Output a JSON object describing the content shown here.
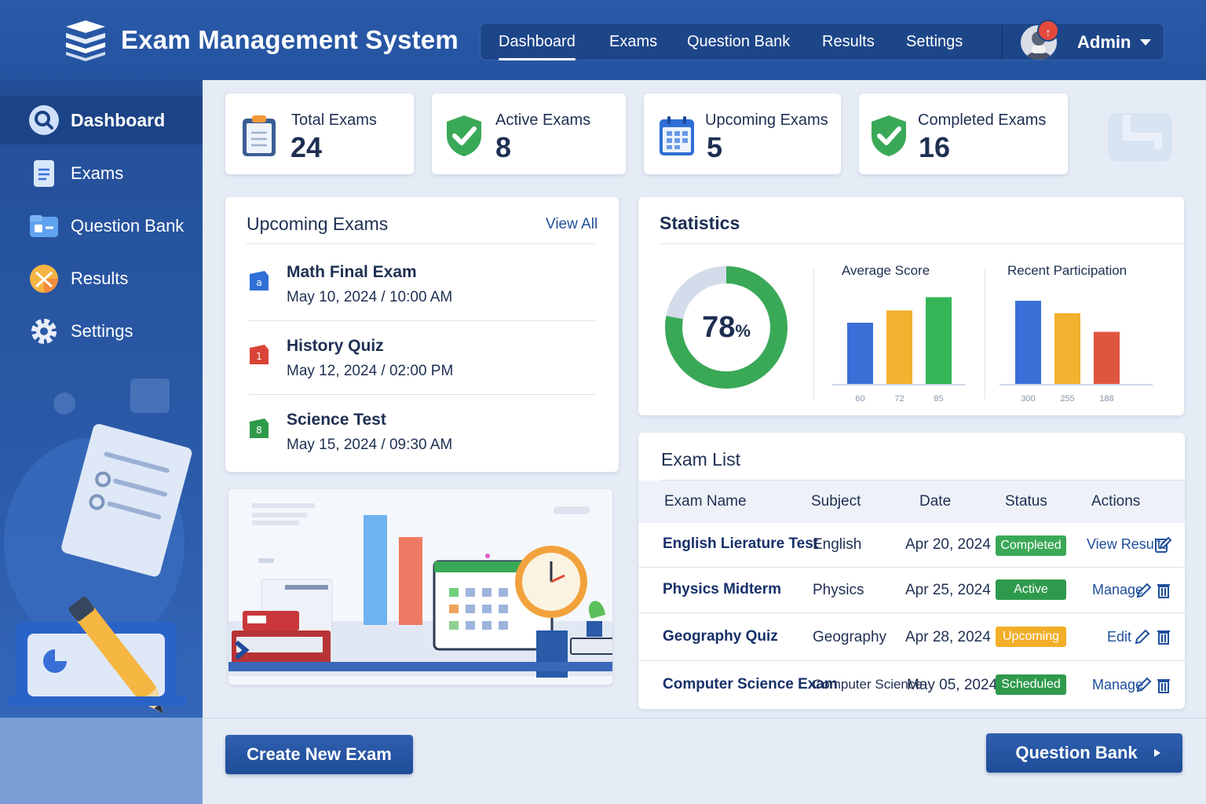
{
  "app": {
    "title": "Exam Management System"
  },
  "nav": {
    "items": [
      {
        "label": "Dashboard",
        "active": true
      },
      {
        "label": "Exams"
      },
      {
        "label": "Question Bank"
      },
      {
        "label": "Results"
      },
      {
        "label": "Settings"
      }
    ],
    "notification_count": "↑",
    "user_label": "Admin"
  },
  "sidebar": {
    "items": [
      {
        "label": "Dashboard",
        "icon": "search-icon",
        "active": true
      },
      {
        "label": "Exams",
        "icon": "document-icon"
      },
      {
        "label": "Question Bank",
        "icon": "folder-icon"
      },
      {
        "label": "Results",
        "icon": "chart-icon"
      },
      {
        "label": "Settings",
        "icon": "gear-icon"
      }
    ]
  },
  "stats": [
    {
      "label": "Total Exams",
      "value": "24",
      "icon": "clipboard-icon"
    },
    {
      "label": "Active Exams",
      "value": "8",
      "icon": "check-shield-icon"
    },
    {
      "label": "Upcoming Exams",
      "value": "5",
      "icon": "calendar-icon"
    },
    {
      "label": "Completed Exams",
      "value": "16",
      "icon": "check-shield-icon"
    }
  ],
  "upcoming": {
    "title": "Upcoming Exams",
    "view_all": "View All",
    "items": [
      {
        "name": "Math Final Exam",
        "date": "May 10, 2024 / 10:00 AM",
        "icon_letter": "a",
        "color": "#2f6fd6"
      },
      {
        "name": "History Quiz",
        "date": "May 12, 2024 / 02:00 PM",
        "icon_letter": "1",
        "color": "#d94436"
      },
      {
        "name": "Science Test",
        "date": "May 15, 2024 / 09:30 AM",
        "icon_letter": "8",
        "color": "#2f9a4a"
      }
    ]
  },
  "statistics": {
    "title": "Statistics",
    "donut": {
      "value": 78,
      "number": "78",
      "unit": "%"
    },
    "avg_title": "Average Score",
    "part_title": "Recent Participation"
  },
  "chart_data": [
    {
      "type": "pie",
      "values": [
        78,
        22
      ],
      "center_label": "78%"
    },
    {
      "type": "bar",
      "title": "Average Score",
      "categories": [
        "60",
        "72",
        "85"
      ],
      "values": [
        60,
        72,
        85
      ],
      "colors": [
        "#3a6fd8",
        "#f2b12e",
        "#34b556"
      ],
      "ylim": [
        0,
        100
      ]
    },
    {
      "type": "bar",
      "title": "Recent Participation",
      "categories": [
        "300",
        "255",
        "188"
      ],
      "values": [
        300,
        255,
        188
      ],
      "colors": [
        "#3a6fd8",
        "#f2b12e",
        "#e0553f"
      ],
      "ylim": [
        0,
        320
      ]
    }
  ],
  "exam_list": {
    "title": "Exam List",
    "columns": [
      "Exam Name",
      "Subject",
      "Date",
      "Status",
      "Actions"
    ],
    "rows": [
      {
        "name": "English Lierature Test",
        "subject": "English",
        "date": "Apr 20, 2024",
        "status": "Completed",
        "status_color": "#3aa957",
        "action": "View Results",
        "icons": [
          "edit-icon"
        ]
      },
      {
        "name": "Physics Midterm",
        "subject": "Physics",
        "date": "Apr 25, 2024",
        "status": "Active",
        "status_color": "#2e9a4c",
        "action": "Manage",
        "icons": [
          "edit-icon",
          "trash-icon"
        ]
      },
      {
        "name": "Geography Quiz",
        "subject": "Geography",
        "date": "Apr 28, 2024",
        "status": "Upcoming",
        "status_color": "#f2ae28",
        "action": "Edit",
        "icons": [
          "edit-icon",
          "trash-icon"
        ]
      },
      {
        "name": "Computer Science Exam",
        "subject": "Computer Science",
        "date": "May 05, 2024",
        "status": "Scheduled",
        "status_color": "#2f9a4c",
        "action": "Manage",
        "icons": [
          "edit-icon",
          "trash-icon"
        ]
      }
    ]
  },
  "buttons": {
    "create": "Create New Exam",
    "question_bank": "Question Bank"
  },
  "colors": {
    "primary": "#2453a0",
    "sidebar_active": "#1c4386",
    "background": "#e6ecf5"
  }
}
